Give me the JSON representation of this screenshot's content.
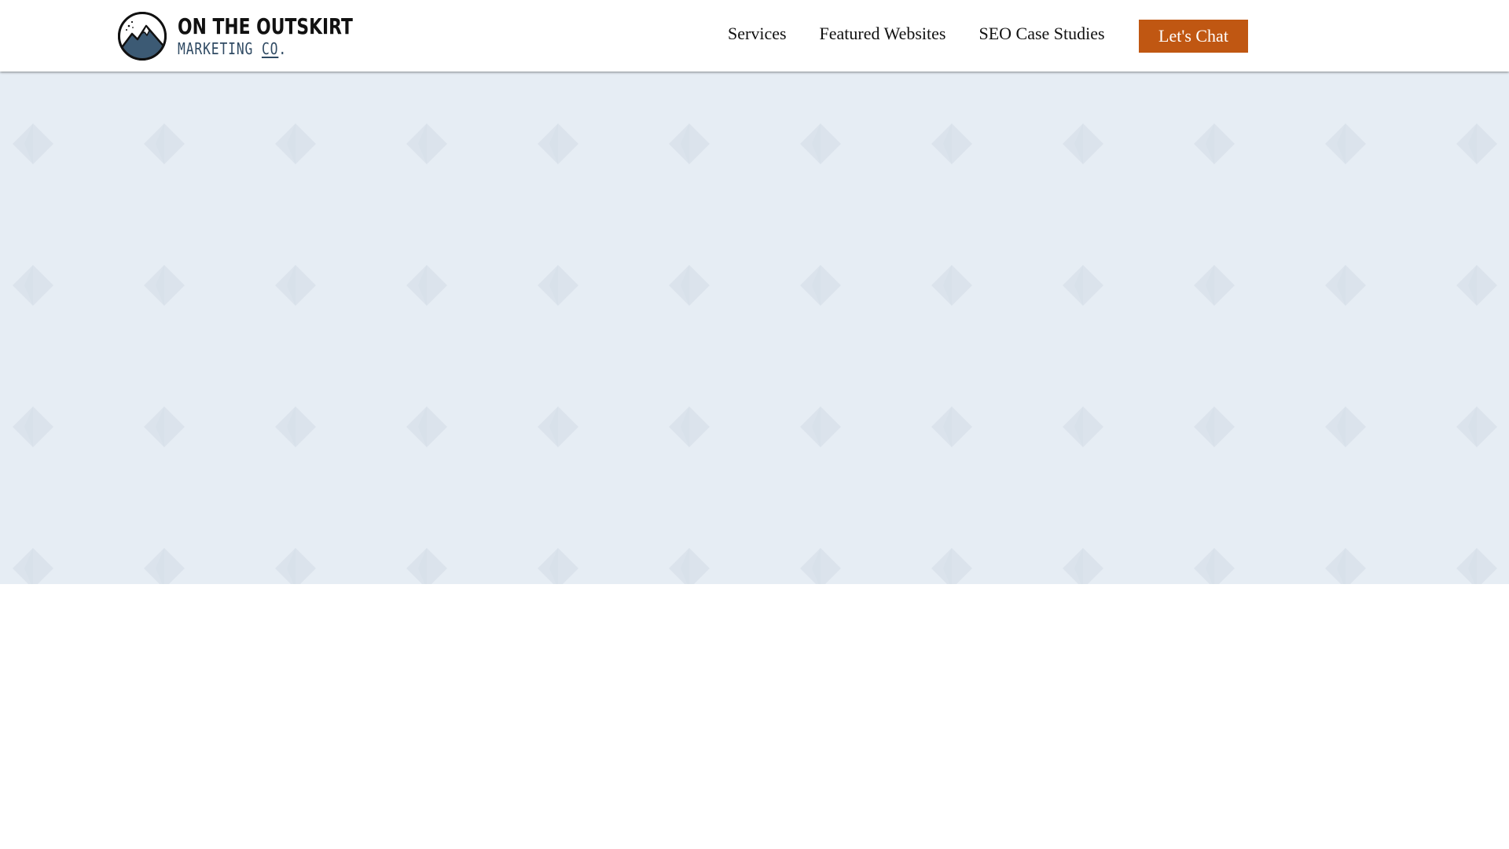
{
  "header": {
    "logo": {
      "line1": "ON THE OUTSKIRT",
      "line2_main": "MARKETING ",
      "line2_co": "CO",
      "line2_dot": ".",
      "icon": "mountain-logo-icon"
    },
    "nav": [
      {
        "label": "Services"
      },
      {
        "label": "Featured Websites"
      },
      {
        "label": "SEO Case Studies"
      }
    ],
    "cta_label": "Let's Chat"
  },
  "colors": {
    "cta_background": "#c05712",
    "hero_background": "#e6edf4",
    "hero_pattern": "#dbe3ec",
    "logo_navy": "#2f4a63"
  }
}
